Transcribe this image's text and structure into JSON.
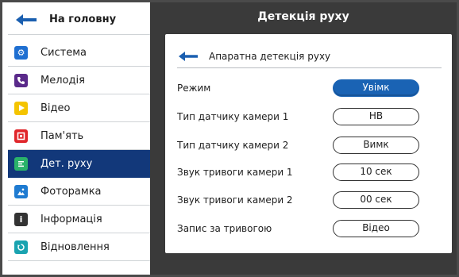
{
  "colors": {
    "sidebar_active": "#12387a",
    "pill_on": "#1a63b4",
    "background": "#3a3a3a",
    "icon_system": "#1f6fd1",
    "icon_melody": "#5a2a8a",
    "icon_video": "#f4c400",
    "icon_memory": "#e0262b",
    "icon_motion": "#2ab36a",
    "icon_photoframe": "#1f7bd1",
    "icon_info": "#333333",
    "icon_restore": "#1aa3b0"
  },
  "sidebar": {
    "home_label": "На головну",
    "items": [
      {
        "label": "Система",
        "icon": "gear-icon"
      },
      {
        "label": "Мелодія",
        "icon": "phone-icon"
      },
      {
        "label": "Відео",
        "icon": "play-icon"
      },
      {
        "label": "Пам'ять",
        "icon": "memory-icon"
      },
      {
        "label": "Дет. руху",
        "icon": "motion-icon",
        "active": true
      },
      {
        "label": "Фоторамка",
        "icon": "photo-icon"
      },
      {
        "label": "Інформація",
        "icon": "info-icon"
      },
      {
        "label": "Відновлення",
        "icon": "restore-icon"
      }
    ]
  },
  "header": {
    "title": "Детекція руху"
  },
  "panel": {
    "sub_title": "Апаратна детекція руху",
    "settings": [
      {
        "label": "Режим",
        "value": "Увімк",
        "on": true
      },
      {
        "label": "Тип датчику камери 1",
        "value": "НВ"
      },
      {
        "label": "Тип датчику камери 2",
        "value": "Вимк"
      },
      {
        "label": "Звук тривоги камери 1",
        "value": "10 сек"
      },
      {
        "label": "Звук тривоги камери 2",
        "value": "00 сек"
      },
      {
        "label": "Запис за тривогою",
        "value": "Відео"
      }
    ]
  }
}
